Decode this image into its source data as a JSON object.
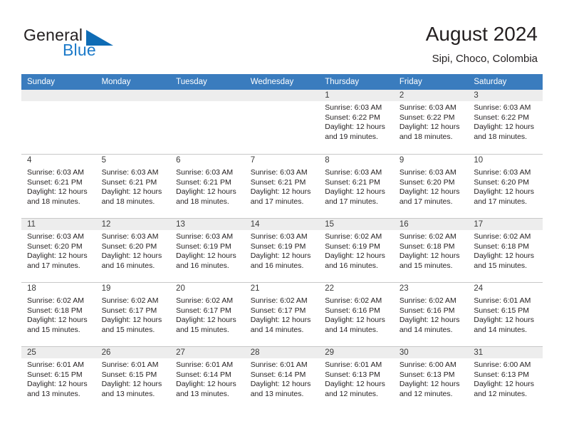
{
  "brand": {
    "name_part1": "General",
    "name_part2": "Blue",
    "accent_color": "#0f6cb5"
  },
  "header": {
    "title": "August 2024",
    "location": "Sipi, Choco, Colombia",
    "header_bg": "#3a7cbe"
  },
  "weekdays": [
    "Sunday",
    "Monday",
    "Tuesday",
    "Wednesday",
    "Thursday",
    "Friday",
    "Saturday"
  ],
  "labels": {
    "sunrise": "Sunrise:",
    "sunset": "Sunset:",
    "daylight": "Daylight:"
  },
  "weeks": [
    [
      {
        "day": "",
        "sunrise": "",
        "sunset": "",
        "daylight1": "",
        "daylight2": ""
      },
      {
        "day": "",
        "sunrise": "",
        "sunset": "",
        "daylight1": "",
        "daylight2": ""
      },
      {
        "day": "",
        "sunrise": "",
        "sunset": "",
        "daylight1": "",
        "daylight2": ""
      },
      {
        "day": "",
        "sunrise": "",
        "sunset": "",
        "daylight1": "",
        "daylight2": ""
      },
      {
        "day": "1",
        "sunrise": "Sunrise: 6:03 AM",
        "sunset": "Sunset: 6:22 PM",
        "daylight1": "Daylight: 12 hours",
        "daylight2": "and 19 minutes."
      },
      {
        "day": "2",
        "sunrise": "Sunrise: 6:03 AM",
        "sunset": "Sunset: 6:22 PM",
        "daylight1": "Daylight: 12 hours",
        "daylight2": "and 18 minutes."
      },
      {
        "day": "3",
        "sunrise": "Sunrise: 6:03 AM",
        "sunset": "Sunset: 6:22 PM",
        "daylight1": "Daylight: 12 hours",
        "daylight2": "and 18 minutes."
      }
    ],
    [
      {
        "day": "4",
        "sunrise": "Sunrise: 6:03 AM",
        "sunset": "Sunset: 6:21 PM",
        "daylight1": "Daylight: 12 hours",
        "daylight2": "and 18 minutes."
      },
      {
        "day": "5",
        "sunrise": "Sunrise: 6:03 AM",
        "sunset": "Sunset: 6:21 PM",
        "daylight1": "Daylight: 12 hours",
        "daylight2": "and 18 minutes."
      },
      {
        "day": "6",
        "sunrise": "Sunrise: 6:03 AM",
        "sunset": "Sunset: 6:21 PM",
        "daylight1": "Daylight: 12 hours",
        "daylight2": "and 18 minutes."
      },
      {
        "day": "7",
        "sunrise": "Sunrise: 6:03 AM",
        "sunset": "Sunset: 6:21 PM",
        "daylight1": "Daylight: 12 hours",
        "daylight2": "and 17 minutes."
      },
      {
        "day": "8",
        "sunrise": "Sunrise: 6:03 AM",
        "sunset": "Sunset: 6:21 PM",
        "daylight1": "Daylight: 12 hours",
        "daylight2": "and 17 minutes."
      },
      {
        "day": "9",
        "sunrise": "Sunrise: 6:03 AM",
        "sunset": "Sunset: 6:20 PM",
        "daylight1": "Daylight: 12 hours",
        "daylight2": "and 17 minutes."
      },
      {
        "day": "10",
        "sunrise": "Sunrise: 6:03 AM",
        "sunset": "Sunset: 6:20 PM",
        "daylight1": "Daylight: 12 hours",
        "daylight2": "and 17 minutes."
      }
    ],
    [
      {
        "day": "11",
        "sunrise": "Sunrise: 6:03 AM",
        "sunset": "Sunset: 6:20 PM",
        "daylight1": "Daylight: 12 hours",
        "daylight2": "and 17 minutes."
      },
      {
        "day": "12",
        "sunrise": "Sunrise: 6:03 AM",
        "sunset": "Sunset: 6:20 PM",
        "daylight1": "Daylight: 12 hours",
        "daylight2": "and 16 minutes."
      },
      {
        "day": "13",
        "sunrise": "Sunrise: 6:03 AM",
        "sunset": "Sunset: 6:19 PM",
        "daylight1": "Daylight: 12 hours",
        "daylight2": "and 16 minutes."
      },
      {
        "day": "14",
        "sunrise": "Sunrise: 6:03 AM",
        "sunset": "Sunset: 6:19 PM",
        "daylight1": "Daylight: 12 hours",
        "daylight2": "and 16 minutes."
      },
      {
        "day": "15",
        "sunrise": "Sunrise: 6:02 AM",
        "sunset": "Sunset: 6:19 PM",
        "daylight1": "Daylight: 12 hours",
        "daylight2": "and 16 minutes."
      },
      {
        "day": "16",
        "sunrise": "Sunrise: 6:02 AM",
        "sunset": "Sunset: 6:18 PM",
        "daylight1": "Daylight: 12 hours",
        "daylight2": "and 15 minutes."
      },
      {
        "day": "17",
        "sunrise": "Sunrise: 6:02 AM",
        "sunset": "Sunset: 6:18 PM",
        "daylight1": "Daylight: 12 hours",
        "daylight2": "and 15 minutes."
      }
    ],
    [
      {
        "day": "18",
        "sunrise": "Sunrise: 6:02 AM",
        "sunset": "Sunset: 6:18 PM",
        "daylight1": "Daylight: 12 hours",
        "daylight2": "and 15 minutes."
      },
      {
        "day": "19",
        "sunrise": "Sunrise: 6:02 AM",
        "sunset": "Sunset: 6:17 PM",
        "daylight1": "Daylight: 12 hours",
        "daylight2": "and 15 minutes."
      },
      {
        "day": "20",
        "sunrise": "Sunrise: 6:02 AM",
        "sunset": "Sunset: 6:17 PM",
        "daylight1": "Daylight: 12 hours",
        "daylight2": "and 15 minutes."
      },
      {
        "day": "21",
        "sunrise": "Sunrise: 6:02 AM",
        "sunset": "Sunset: 6:17 PM",
        "daylight1": "Daylight: 12 hours",
        "daylight2": "and 14 minutes."
      },
      {
        "day": "22",
        "sunrise": "Sunrise: 6:02 AM",
        "sunset": "Sunset: 6:16 PM",
        "daylight1": "Daylight: 12 hours",
        "daylight2": "and 14 minutes."
      },
      {
        "day": "23",
        "sunrise": "Sunrise: 6:02 AM",
        "sunset": "Sunset: 6:16 PM",
        "daylight1": "Daylight: 12 hours",
        "daylight2": "and 14 minutes."
      },
      {
        "day": "24",
        "sunrise": "Sunrise: 6:01 AM",
        "sunset": "Sunset: 6:15 PM",
        "daylight1": "Daylight: 12 hours",
        "daylight2": "and 14 minutes."
      }
    ],
    [
      {
        "day": "25",
        "sunrise": "Sunrise: 6:01 AM",
        "sunset": "Sunset: 6:15 PM",
        "daylight1": "Daylight: 12 hours",
        "daylight2": "and 13 minutes."
      },
      {
        "day": "26",
        "sunrise": "Sunrise: 6:01 AM",
        "sunset": "Sunset: 6:15 PM",
        "daylight1": "Daylight: 12 hours",
        "daylight2": "and 13 minutes."
      },
      {
        "day": "27",
        "sunrise": "Sunrise: 6:01 AM",
        "sunset": "Sunset: 6:14 PM",
        "daylight1": "Daylight: 12 hours",
        "daylight2": "and 13 minutes."
      },
      {
        "day": "28",
        "sunrise": "Sunrise: 6:01 AM",
        "sunset": "Sunset: 6:14 PM",
        "daylight1": "Daylight: 12 hours",
        "daylight2": "and 13 minutes."
      },
      {
        "day": "29",
        "sunrise": "Sunrise: 6:01 AM",
        "sunset": "Sunset: 6:13 PM",
        "daylight1": "Daylight: 12 hours",
        "daylight2": "and 12 minutes."
      },
      {
        "day": "30",
        "sunrise": "Sunrise: 6:00 AM",
        "sunset": "Sunset: 6:13 PM",
        "daylight1": "Daylight: 12 hours",
        "daylight2": "and 12 minutes."
      },
      {
        "day": "31",
        "sunrise": "Sunrise: 6:00 AM",
        "sunset": "Sunset: 6:13 PM",
        "daylight1": "Daylight: 12 hours",
        "daylight2": "and 12 minutes."
      }
    ]
  ]
}
